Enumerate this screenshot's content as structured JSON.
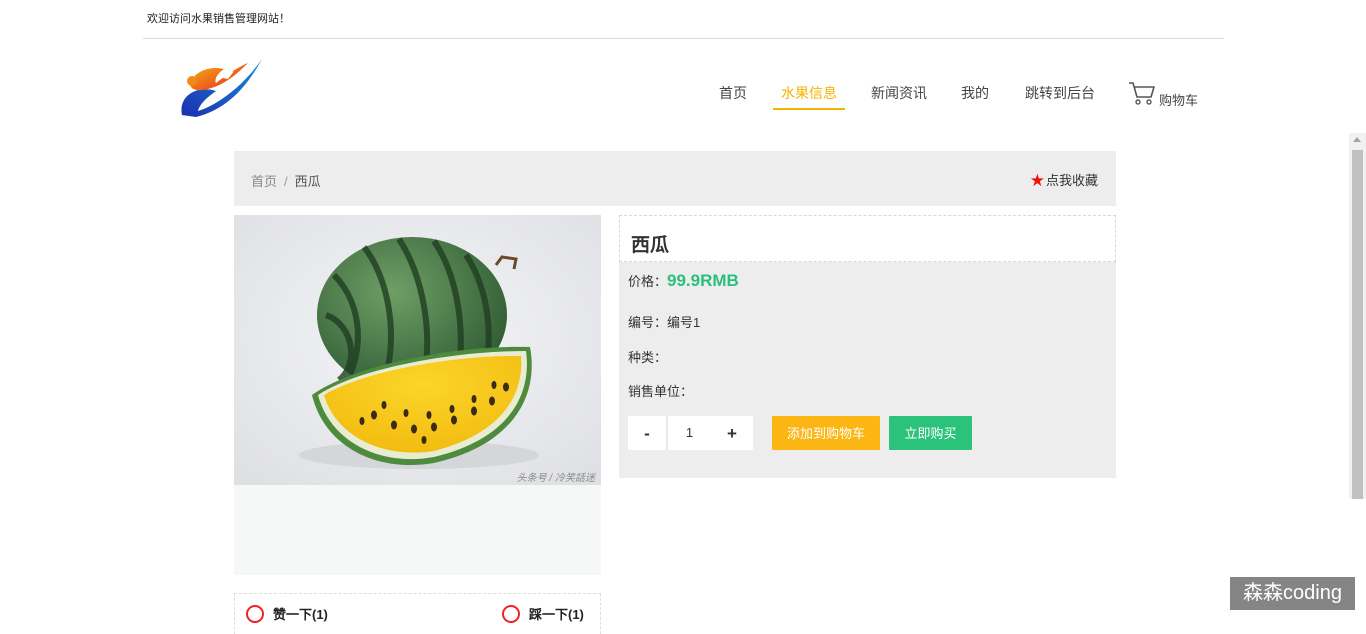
{
  "header": {
    "welcome": "欢迎访问水果销售管理网站！"
  },
  "nav": {
    "items": [
      {
        "label": "首页",
        "active": false
      },
      {
        "label": "水果信息",
        "active": true
      },
      {
        "label": "新闻资讯",
        "active": false
      },
      {
        "label": "我的",
        "active": false
      },
      {
        "label": "跳转到后台",
        "active": false
      }
    ],
    "cart_label": "购物车",
    "active_color": "#f5b400"
  },
  "breadcrumb": {
    "home": "首页",
    "separator": "/",
    "current": "西瓜"
  },
  "favorite": {
    "label": "点我收藏",
    "icon": "star-icon"
  },
  "product": {
    "name": "西瓜",
    "price_label": "价格：",
    "price": "99.9RMB",
    "code_label": "编号：",
    "code": "编号1",
    "category_label": "种类：",
    "category": "",
    "unit_label": "销售单位：",
    "unit": "",
    "image_caption": "头条号 / 冷笑話迷",
    "price_color": "#2bbf7e"
  },
  "purchase": {
    "minus": "-",
    "quantity": "1",
    "plus": "+",
    "add_to_cart": "添加到购物车",
    "buy_now": "立即购买",
    "cart_color": "#fbb613",
    "buy_color": "#2bc37c"
  },
  "votes": {
    "like_label": "赞一下(1)",
    "dislike_label": "踩一下(1)"
  },
  "badge": {
    "text": "森森coding"
  }
}
